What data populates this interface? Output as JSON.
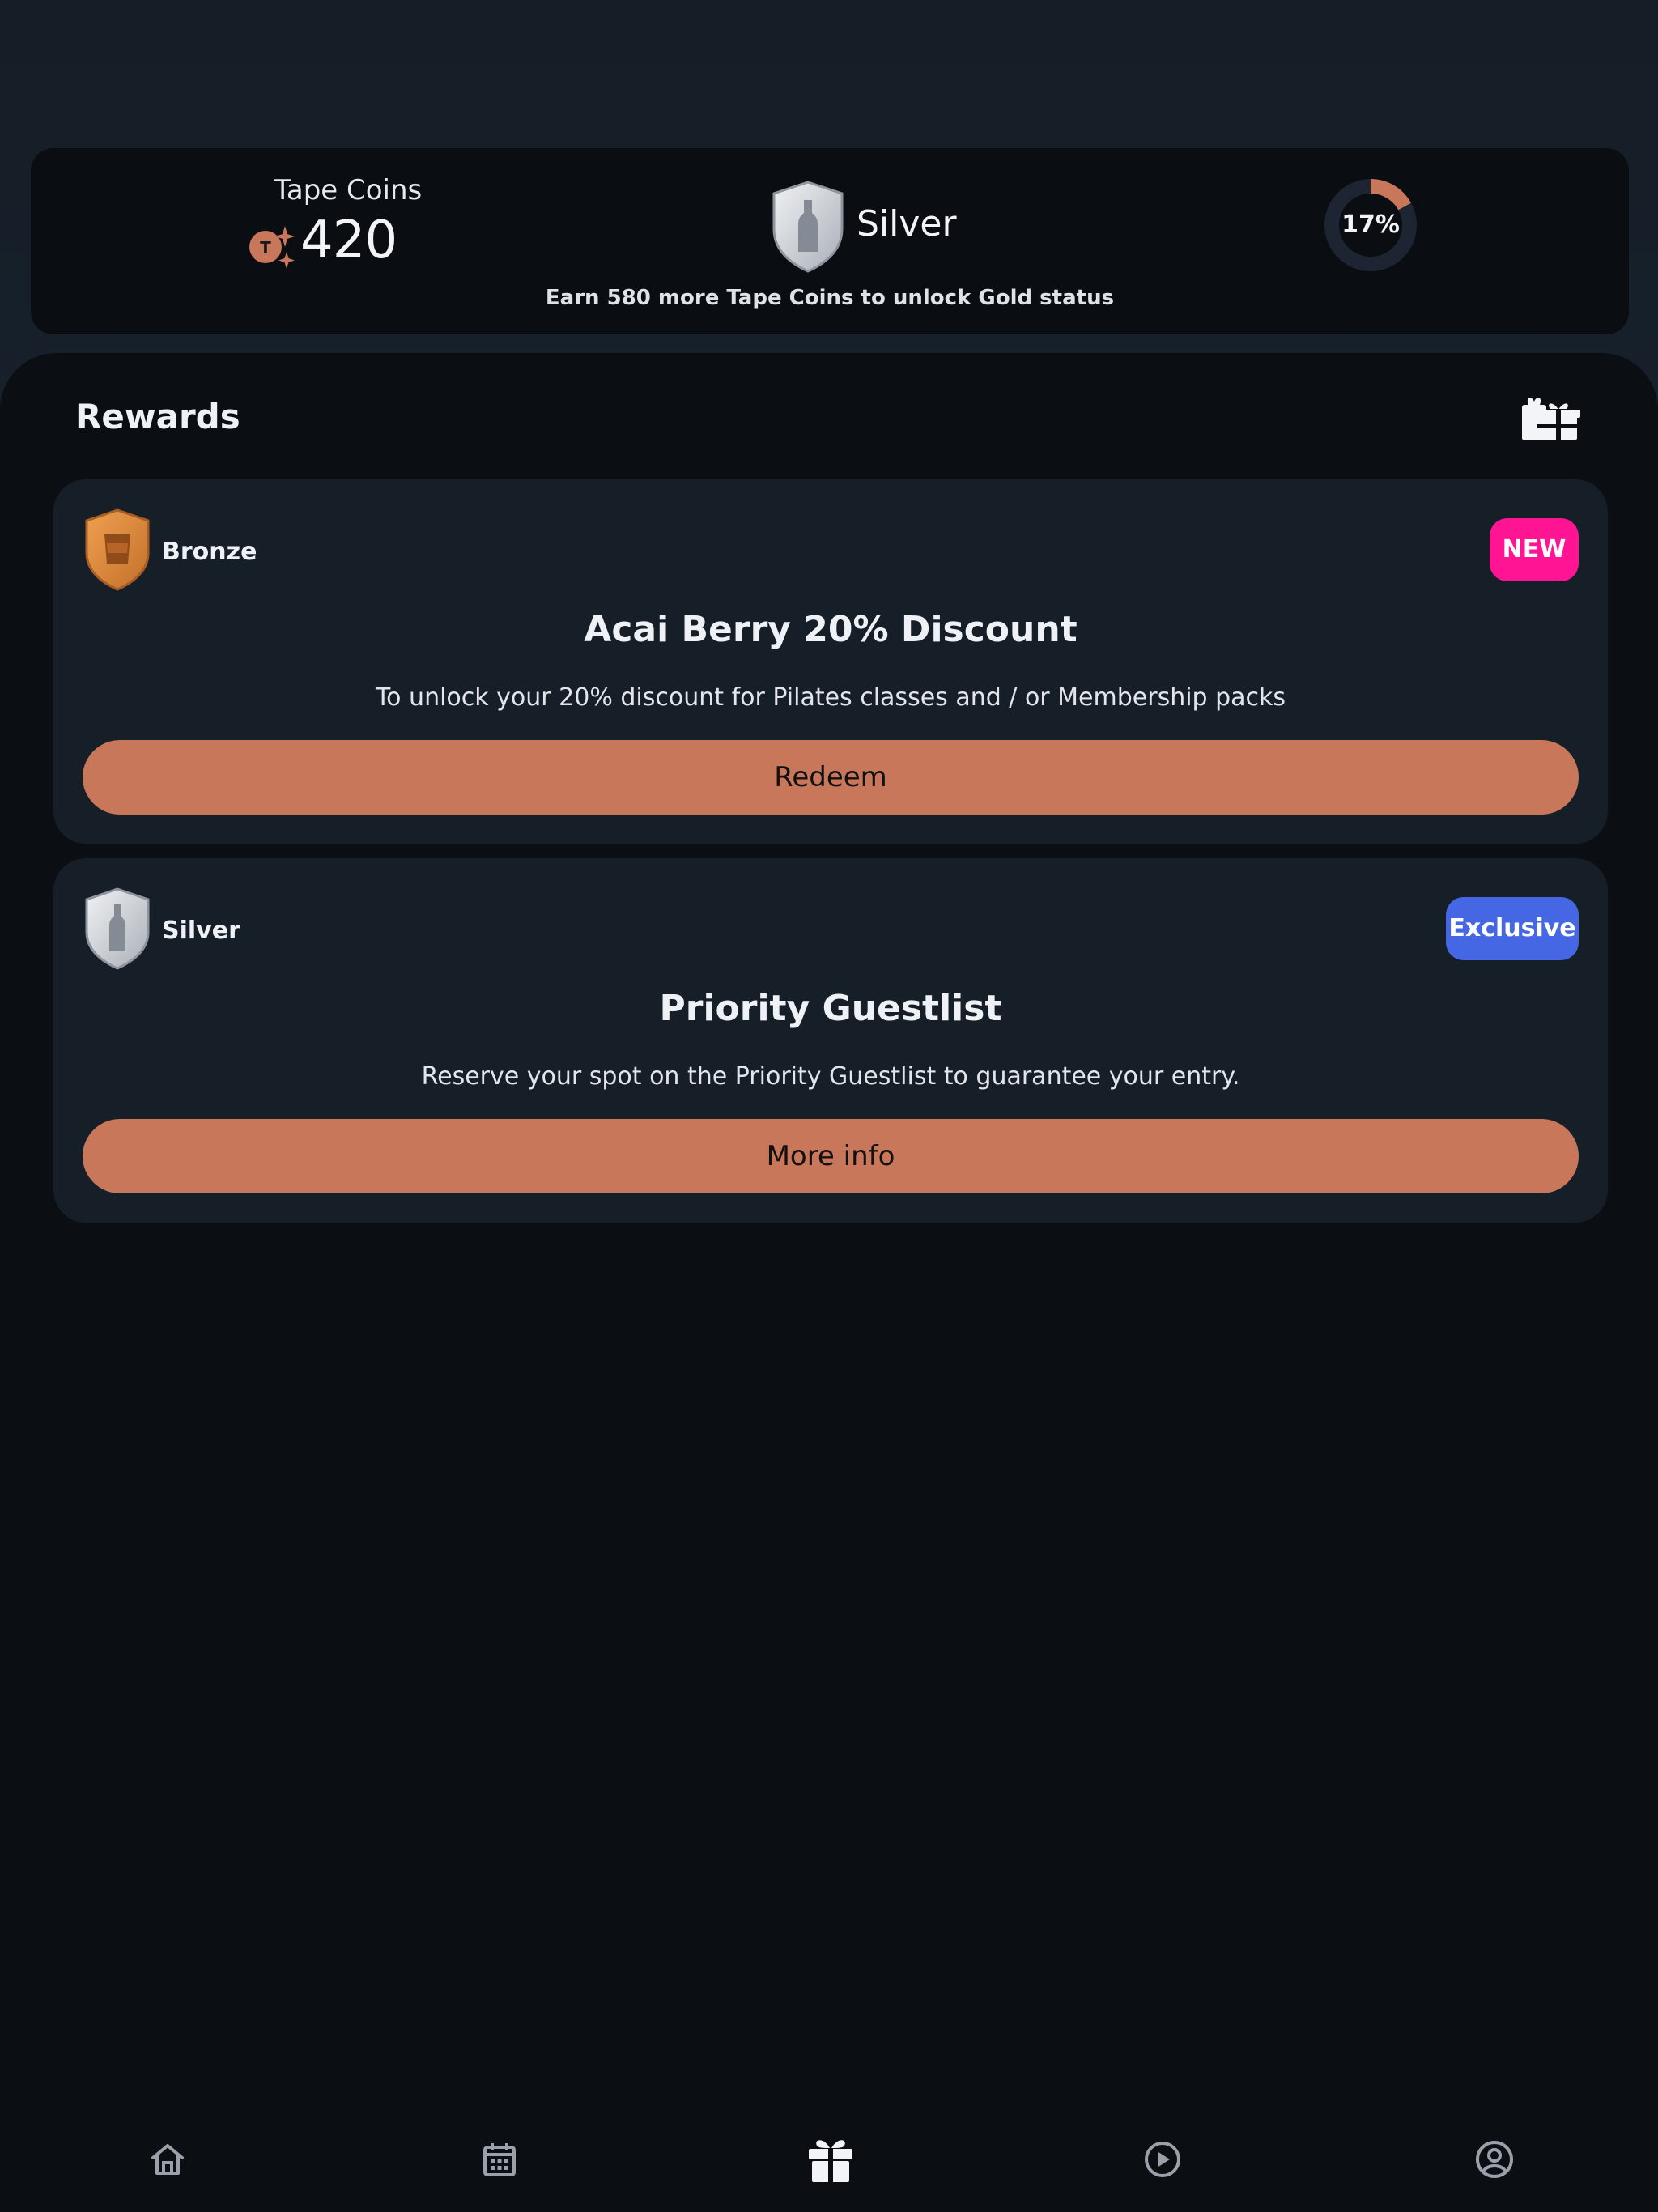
{
  "status": {
    "coins_label": "Tape Coins",
    "coins_value": "420",
    "tier": "Silver",
    "progress_percent": 17,
    "progress_label": "17%",
    "message": "Earn 580 more Tape Coins to unlock Gold status"
  },
  "rewards": {
    "title": "Rewards",
    "items": [
      {
        "tier": "Bronze",
        "badge": "NEW",
        "title": "Acai Berry 20% Discount",
        "description": "To unlock your 20% discount for Pilates classes and / or Membership packs",
        "button": "Redeem"
      },
      {
        "tier": "Silver",
        "badge": "Exclusive",
        "title": "Priority Guestlist",
        "description": "Reserve your spot on the Priority Guestlist to guarantee your entry.",
        "button": "More info"
      }
    ]
  },
  "nav": {
    "items": [
      "home-icon",
      "calendar-icon",
      "gift-icon",
      "play-circle-icon",
      "account-circle-icon"
    ],
    "active": "gift-icon"
  },
  "colors": {
    "accent": "#c8775a",
    "new_badge": "#ff1493",
    "exclusive_badge": "#4567e4",
    "card_bg": "#161e28",
    "page_bg": "#0b0e13"
  }
}
